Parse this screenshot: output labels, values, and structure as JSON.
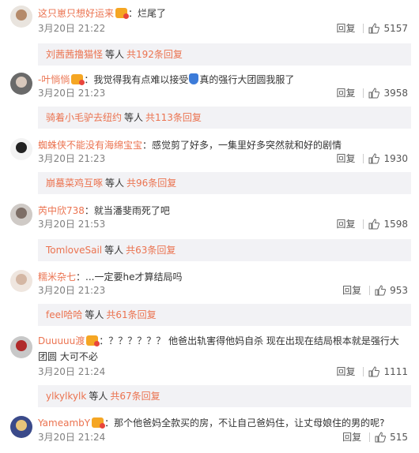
{
  "comments": [
    {
      "username": "这只崽只想好运来",
      "text": "烂尾了",
      "time": "3月20日 21:22",
      "reply_label": "回复",
      "likes": "5157",
      "sub": {
        "who": "刘茜茜撸猫怪",
        "etc": "等人",
        "more": "共192条回复"
      },
      "avatar_colors": [
        "#e9e4de",
        "#b58a6a"
      ]
    },
    {
      "username": "-叶惝惝",
      "text_pre": "我觉得我有点难以接受",
      "text_post": "真的强行大团圆我服了",
      "emoji_icon": "bottle-emoji-icon",
      "time": "3月20日 21:23",
      "reply_label": "回复",
      "likes": "3958",
      "sub": {
        "who": "骑着小毛驴去纽约",
        "etc": "等人",
        "more": "共113条回复"
      },
      "avatar_colors": [
        "#6a6a6a",
        "#d8c8bc"
      ]
    },
    {
      "username": "蜘蛛侠不能没有海绵宝宝",
      "text": "感觉剪了好多，一集里好多突然就和好的剧情",
      "time": "3月20日 21:23",
      "reply_label": "回复",
      "likes": "1930",
      "sub": {
        "who": "崩墓菜鸡互啄",
        "etc": "等人",
        "more": "共96条回复"
      },
      "avatar_colors": [
        "#f3f3f3",
        "#222222"
      ]
    },
    {
      "username": "芮中欣738",
      "text": "就当潘斐雨死了吧",
      "time": "3月20日 21:53",
      "reply_label": "回复",
      "likes": "1598",
      "sub": {
        "who": "TomloveSail",
        "etc": "等人",
        "more": "共63条回复"
      },
      "avatar_colors": [
        "#cfcac6",
        "#7d6e66"
      ]
    },
    {
      "username": "糯米杂七",
      "text": "...一定要he才算结局吗",
      "time": "3月20日 21:23",
      "reply_label": "回复",
      "likes": "953",
      "sub": {
        "who": "feel哈哈",
        "etc": "等人",
        "more": "共61条回复"
      },
      "avatar_colors": [
        "#efe6df",
        "#d4b7a4"
      ]
    },
    {
      "username": "Duuuuu渡",
      "text": "？？？？？？ 他爸出轨害得他妈自杀 现在出现在结局根本就是强行大团圆 大可不必",
      "time": "3月20日 21:24",
      "reply_label": "回复",
      "likes": "1111",
      "sub": {
        "who": "ylkylkylk",
        "etc": "等人",
        "more": "共67条回复"
      },
      "avatar_colors": [
        "#c8c8c8",
        "#b02a2a"
      ]
    },
    {
      "username": "YameambY",
      "text": "那个他爸妈全款买的房，不让自己爸妈住，让丈母娘住的男的呢?",
      "time": "3月20日 21:24",
      "reply_label": "回复",
      "likes": "515",
      "avatar_colors": [
        "#3a4a8a",
        "#e8c47a"
      ]
    }
  ]
}
